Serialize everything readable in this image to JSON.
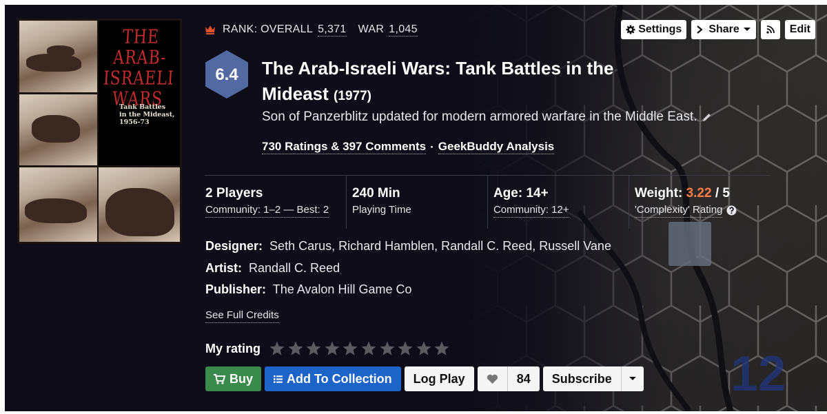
{
  "rank": {
    "icon": "crown-icon",
    "overall_label": "RANK: OVERALL",
    "overall_value": "5,371",
    "war_label": "WAR",
    "war_value": "1,045"
  },
  "toolbar": {
    "settings": "Settings",
    "share": "Share",
    "edit": "Edit"
  },
  "game": {
    "rating": "6.4",
    "title": "The Arab-Israeli Wars: Tank Battles in the Mideast",
    "year": "(1977)",
    "description": "Son of Panzerblitz updated for modern armored warfare in the Middle East.",
    "ratings_comments": "730 Ratings & 397 Comments",
    "separator": "·",
    "analysis": "GeekBuddy Analysis"
  },
  "cover": {
    "title_lines": [
      "THE",
      "ARAB-",
      "ISRAELI",
      "WARS"
    ],
    "subtitle_lines": [
      "Tank Battles",
      "in the Mideast,",
      "1956-73"
    ]
  },
  "stats": {
    "players": {
      "title": "2 Players",
      "sub": "Community: 1–2 — Best: 2"
    },
    "time": {
      "title": "240 Min",
      "sub": "Playing Time"
    },
    "age": {
      "title": "Age: 14+",
      "sub": "Community: 12+"
    },
    "weight": {
      "label": "Weight:",
      "value": "3.22",
      "max": "/ 5",
      "sub": "'Complexity' Rating"
    }
  },
  "credits": {
    "designer_label": "Designer:",
    "designer": "Seth Carus, Richard Hamblen, Randall C. Reed, Russell Vane",
    "artist_label": "Artist:",
    "artist": "Randall C. Reed",
    "publisher_label": "Publisher:",
    "publisher": "The Avalon Hill Game Co",
    "see_full": "See Full Credits"
  },
  "my_rating": {
    "label": "My rating",
    "stars_total": 10,
    "stars_filled": 0
  },
  "actions": {
    "buy": "Buy",
    "add_to_collection": "Add To Collection",
    "log_play": "Log Play",
    "likes": "84",
    "subscribe": "Subscribe"
  },
  "colors": {
    "background": "#0d0c18",
    "rating_hex": "#5369a2",
    "weight_accent": "#ff7c44",
    "buy": "#3a8a4c",
    "collection": "#1c64c8",
    "crown": "#e0522c"
  }
}
